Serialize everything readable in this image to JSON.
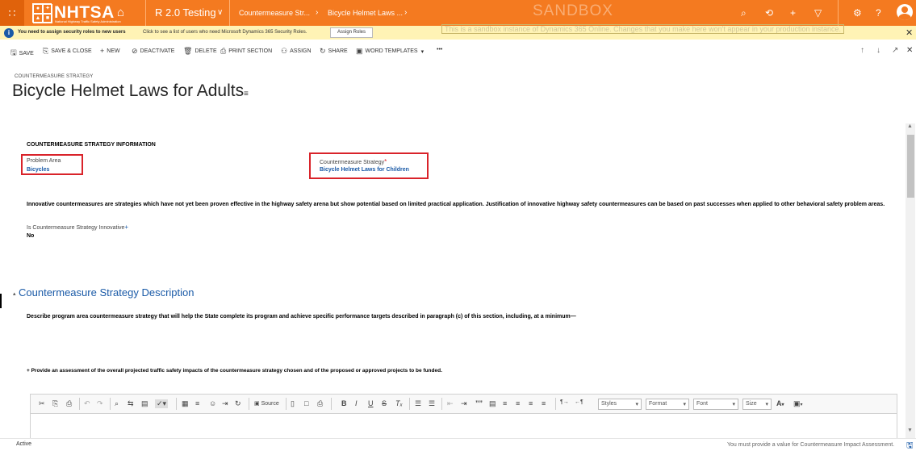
{
  "nav": {
    "logo_text": "NHTSA",
    "logo_sub": "National Highway Traffic Safety Administration",
    "app_title": "R 2.0 Testing",
    "breadcrumb_1": "Countermeasure Str...",
    "breadcrumb_2": "Bicycle Helmet Laws ...",
    "sandbox_label": "SANDBOX"
  },
  "notification": {
    "strong": "You need to assign security roles to new users",
    "note": "Click to see a list of users who need Microsoft Dynamics 365 Security Roles.",
    "button": "Assign Roles",
    "sandbox_note": "This is a sandbox instance of Dynamics 365 Online.  Changes that you make here won't appear in your production instance."
  },
  "commands": {
    "save": "SAVE",
    "save_close": "SAVE & CLOSE",
    "new": "NEW",
    "deactivate": "DEACTIVATE",
    "delete": "DELETE",
    "print": "PRINT SECTION",
    "assign": "ASSIGN",
    "share": "SHARE",
    "word": "WORD TEMPLATES",
    "more": "•••"
  },
  "header": {
    "entity_type": "COUNTERMEASURE STRATEGY",
    "title": "Bicycle Helmet Laws for Adults"
  },
  "form": {
    "section_title": "COUNTERMEASURE STRATEGY INFORMATION",
    "problem_area_label": "Problem Area",
    "problem_area_value": "Bicycles",
    "strategy_label": "Countermeasure Strategy",
    "strategy_value": "Bicycle Helmet Laws for Children",
    "innovative_text": "Innovative countermeasures are strategies which have not yet been proven effective in the highway safety arena but show potential based on limited practical application. Justification of innovative highway safety countermeasures can be based on past successes when applied to other behavioral safety problem areas.",
    "innovative_label": "Is Countermeasure Strategy Innovative",
    "innovative_value": "No",
    "description_heading": "Countermeasure Strategy Description",
    "description_text": "Describe program area countermeasure strategy that will help the State complete its program and achieve specific performance targets described in paragraph (c) of this section, including, at a minimum—",
    "assessment_text": "+ Provide an assessment of the overall projected traffic safety impacts of the countermeasure strategy chosen and of the proposed or approved projects to be funded."
  },
  "editor": {
    "source_label": "Source",
    "styles_label": "Styles",
    "format_label": "Format",
    "font_label": "Font",
    "size_label": "Size"
  },
  "status": {
    "state": "Active",
    "message": "You must provide a value for Countermeasure Impact Assessment."
  },
  "colors": {
    "brand_orange": "#f47a20",
    "link_blue": "#1a5aa7",
    "highlight_red": "#d9232a",
    "notification_yellow": "#fff3b5"
  }
}
